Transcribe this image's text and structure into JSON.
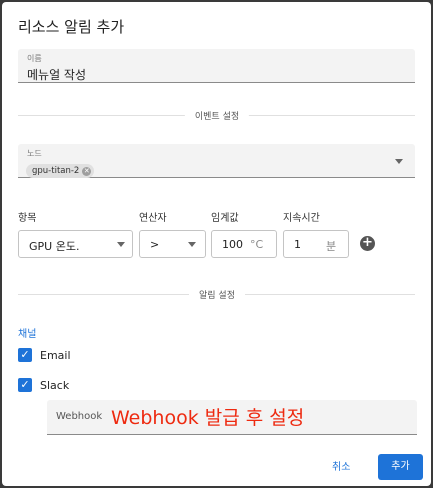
{
  "dialog": {
    "title": "리소스 알림 추가"
  },
  "name_field": {
    "label": "이름",
    "value": "메뉴얼 작성"
  },
  "event_section": {
    "label": "이벤트 설정"
  },
  "node_field": {
    "label": "노드",
    "chip": "gpu-titan-2",
    "chip_remove_icon": "close-icon"
  },
  "condition": {
    "item_label": "항목",
    "operator_label": "연산자",
    "threshold_label": "임계값",
    "duration_label": "지속시간",
    "item_value": "GPU 온도.",
    "operator_value": ">",
    "threshold_value": "100",
    "threshold_unit": "°C",
    "duration_value": "1",
    "duration_unit": "분",
    "add_icon": "add-circle-icon"
  },
  "alarm_section": {
    "label": "알림 설정"
  },
  "channels": {
    "title": "채널",
    "items": [
      {
        "label": "Email",
        "checked": true
      },
      {
        "label": "Slack",
        "checked": true
      }
    ]
  },
  "webhook": {
    "label": "Webhook",
    "note": "Webhook 발급 후 설정"
  },
  "actions": {
    "cancel": "취소",
    "add": "추가"
  },
  "colors": {
    "primary": "#1e73d8",
    "annotation": "#ee2a10"
  }
}
